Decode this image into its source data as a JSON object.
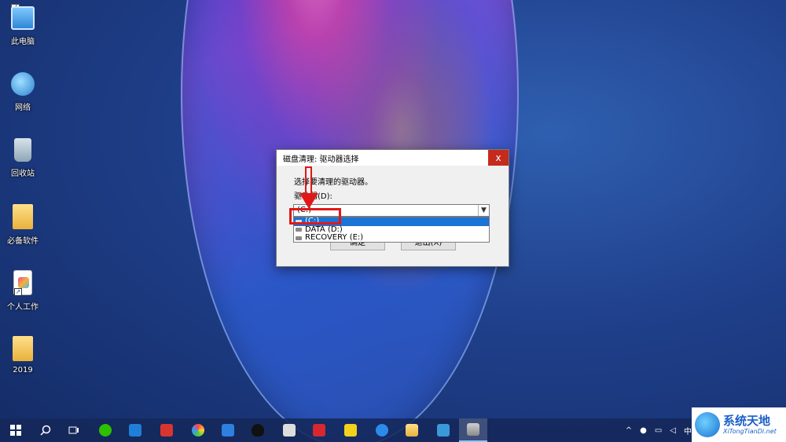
{
  "desktop": {
    "icons": [
      {
        "label": "此电脑",
        "icon": "computer-icon"
      },
      {
        "label": "网络",
        "icon": "network-icon"
      },
      {
        "label": "回收站",
        "icon": "recycle-bin-icon"
      },
      {
        "label": "必备软件",
        "icon": "folder-icon"
      },
      {
        "label": "个人工作",
        "icon": "document-icon"
      },
      {
        "label": "2019",
        "icon": "folder-icon"
      }
    ]
  },
  "dialog": {
    "title": "磁盘清理: 驱动器选择",
    "close_label": "x",
    "instruction": "选择要清理的驱动器。",
    "drive_label": "驱动器(D):",
    "selected_value": "(C:)",
    "options": [
      {
        "label": "(C:)",
        "selected": true
      },
      {
        "label": "DATA (D:)",
        "selected": false
      },
      {
        "label": "RECOVERY (E:)",
        "selected": false
      }
    ],
    "ok_label": "确定",
    "exit_label": "退出(X)"
  },
  "taskbar": {
    "apps": [
      "start-icon",
      "search-icon",
      "task-view-icon",
      "wechat-icon",
      "app-icon",
      "app-icon",
      "app-icon",
      "app-icon",
      "qq-icon",
      "app-icon",
      "app-icon",
      "app-icon",
      "edge-icon",
      "explorer-icon",
      "app-icon",
      "disk-cleanup-icon"
    ],
    "tray_ime": "中"
  },
  "watermark": {
    "cn": "系统天地",
    "en": "XiTongTianDi.net"
  },
  "colors": {
    "accent": "#1a73d6",
    "close_red": "#c42b1c",
    "annotation_red": "#e01818"
  }
}
